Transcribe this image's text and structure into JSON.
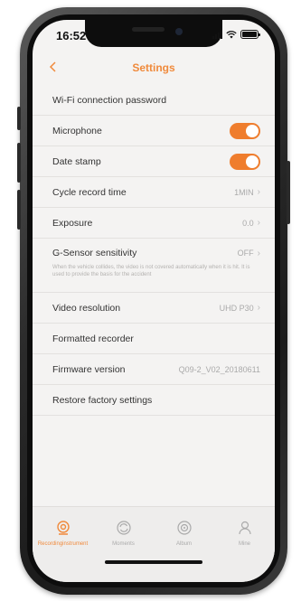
{
  "status_bar": {
    "time": "16:52"
  },
  "nav": {
    "title": "Settings"
  },
  "settings": {
    "wifi_password": "Wi-Fi connection password",
    "microphone": "Microphone",
    "date_stamp": "Date stamp",
    "cycle_record": {
      "label": "Cycle record time",
      "value": "1MIN"
    },
    "exposure": {
      "label": "Exposure",
      "value": "0.0"
    },
    "g_sensor": {
      "label": "G-Sensor sensitivity",
      "value": "OFF",
      "hint": "When the vehicle collides, the video is not covered automatically when it is hit. It is used to provide the basis for the accident"
    },
    "video_resolution": {
      "label": "Video resolution",
      "value": "UHD P30"
    },
    "formatted_recorder": "Formatted recorder",
    "firmware": {
      "label": "Firmware version",
      "value": "Q09-2_V02_20180611"
    },
    "restore": "Restore factory settings"
  },
  "toggles": {
    "microphone_on": true,
    "date_stamp_on": true
  },
  "tabs": [
    {
      "label": "Recordinginstrument",
      "icon": "camera-icon",
      "active": true
    },
    {
      "label": "Moments",
      "icon": "sync-icon",
      "active": false
    },
    {
      "label": "Album",
      "icon": "album-icon",
      "active": false
    },
    {
      "label": "Mine",
      "icon": "person-icon",
      "active": false
    }
  ],
  "colors": {
    "accent": "#f08a3c",
    "toggle": "#ef7d2d",
    "background": "#f4f3f2"
  }
}
